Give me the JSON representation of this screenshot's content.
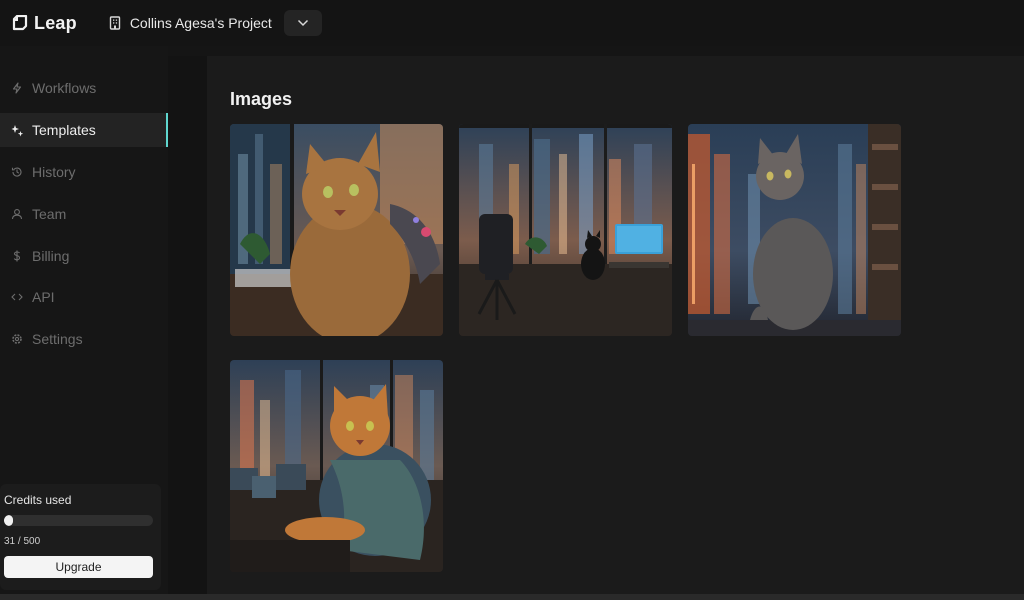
{
  "app": {
    "name": "Leap"
  },
  "project": {
    "name": "Collins Agesa's Project"
  },
  "sidebar": {
    "items": [
      {
        "label": "Workflows",
        "icon": "bolt-icon",
        "active": false
      },
      {
        "label": "Templates",
        "icon": "sparkles-icon",
        "active": true
      },
      {
        "label": "History",
        "icon": "history-icon",
        "active": false
      },
      {
        "label": "Team",
        "icon": "users-icon",
        "active": false
      },
      {
        "label": "Billing",
        "icon": "dollar-icon",
        "active": false
      },
      {
        "label": "API",
        "icon": "code-icon",
        "active": false
      },
      {
        "label": "Settings",
        "icon": "gear-icon",
        "active": false
      }
    ]
  },
  "credits": {
    "title": "Credits used",
    "used": 31,
    "total": 500,
    "count_text": "31 / 500",
    "upgrade_label": "Upgrade"
  },
  "main": {
    "title": "Images",
    "images": [
      {
        "name": "cat-at-desk-with-robot-arm"
      },
      {
        "name": "cat-in-office-chair-city-view"
      },
      {
        "name": "cat-sitting-at-window-skyline"
      },
      {
        "name": "cat-in-jacket-at-desk"
      }
    ]
  },
  "colors": {
    "accent": "#5fd7cf",
    "background": "#1b1b1b"
  }
}
